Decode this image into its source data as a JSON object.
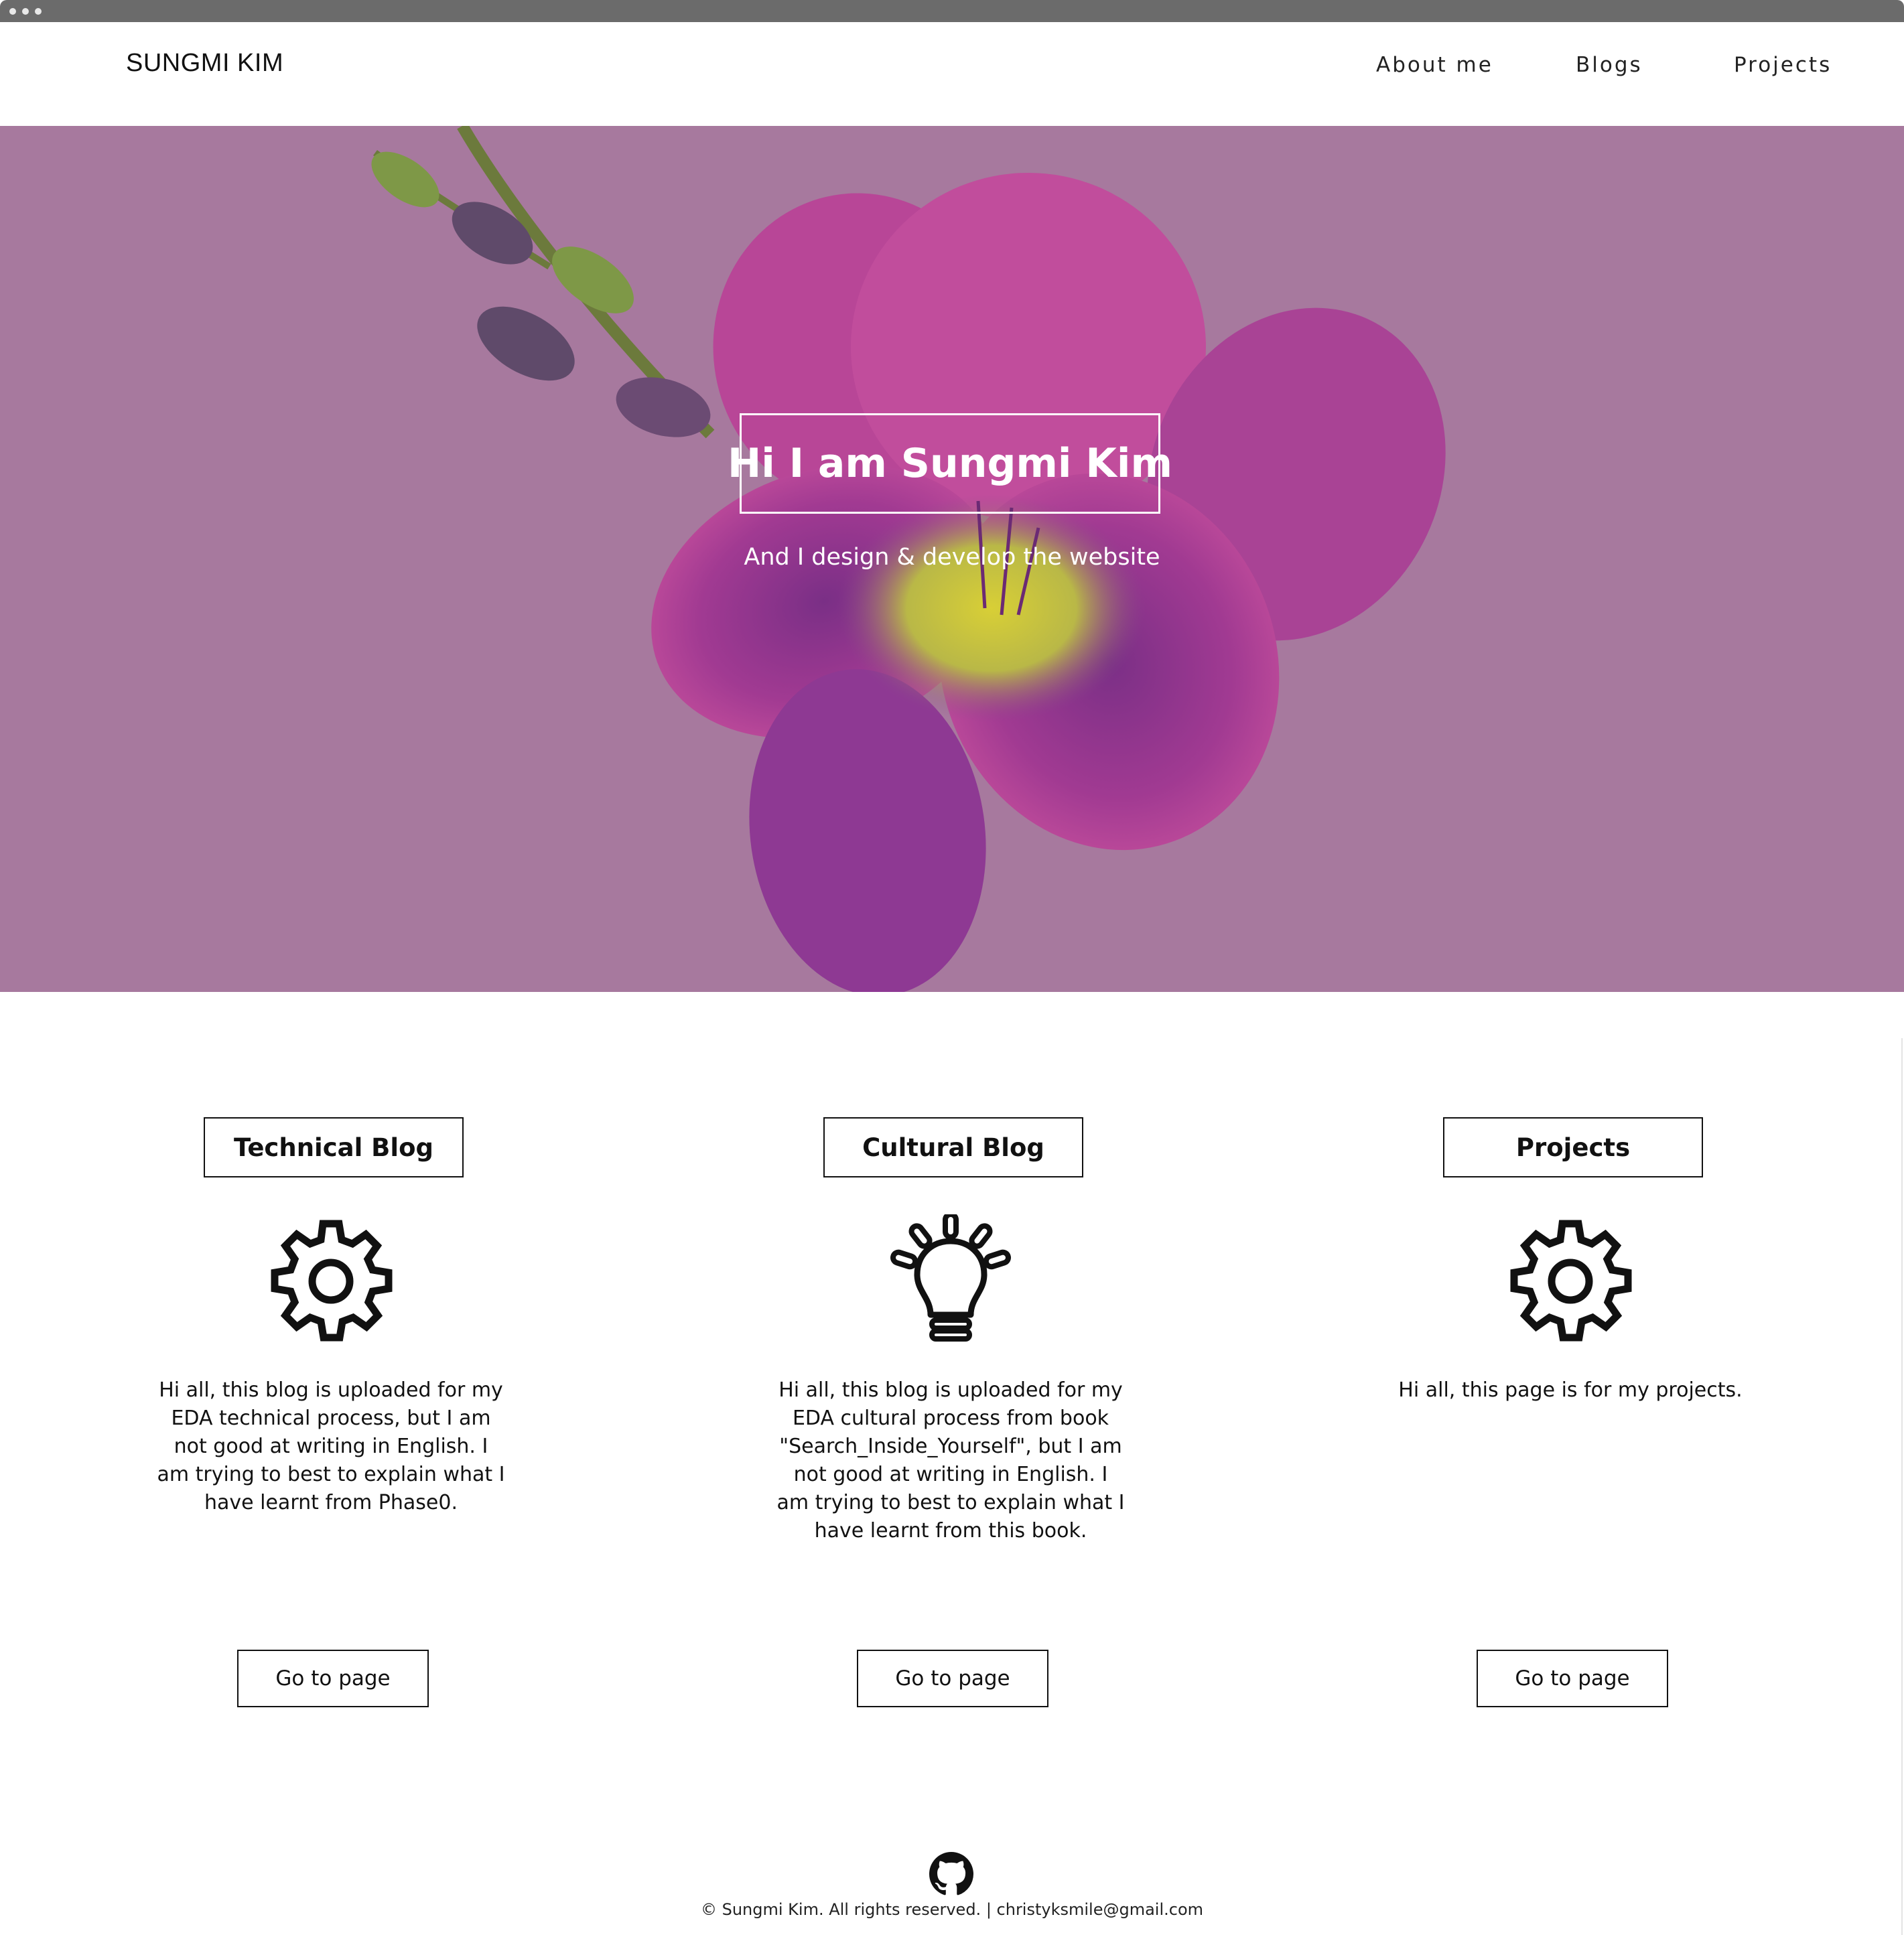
{
  "header": {
    "brand": "SUNGMI KIM",
    "nav": [
      {
        "label": "About me"
      },
      {
        "label": "Blogs"
      },
      {
        "label": "Projects"
      }
    ]
  },
  "hero": {
    "title": "Hi I am Sungmi Kim",
    "subtitle": "And I design & develop the website",
    "background_color": "#a7799e"
  },
  "cards": [
    {
      "heading": "Technical Blog",
      "icon": "gear-icon",
      "text": "Hi all, this blog is uploaded for my EDA technical process, but I am not good at writing in English. I am trying to best to explain what I have learnt from Phase0.",
      "button": "Go to page"
    },
    {
      "heading": "Cultural Blog",
      "icon": "lightbulb-icon",
      "text": "Hi all, this blog is uploaded for my EDA cultural process from book \"Search_Inside_Yourself\", but I am not good at writing in English. I am trying to best to explain what I have learnt from this book.",
      "button": "Go to page"
    },
    {
      "heading": "Projects",
      "icon": "gear-icon",
      "text": "Hi all, this page is for my projects.",
      "button": "Go to page"
    }
  ],
  "footer": {
    "icon": "github-icon",
    "text": "© Sungmi Kim. All rights reserved. | christyksmile@gmail.com"
  }
}
